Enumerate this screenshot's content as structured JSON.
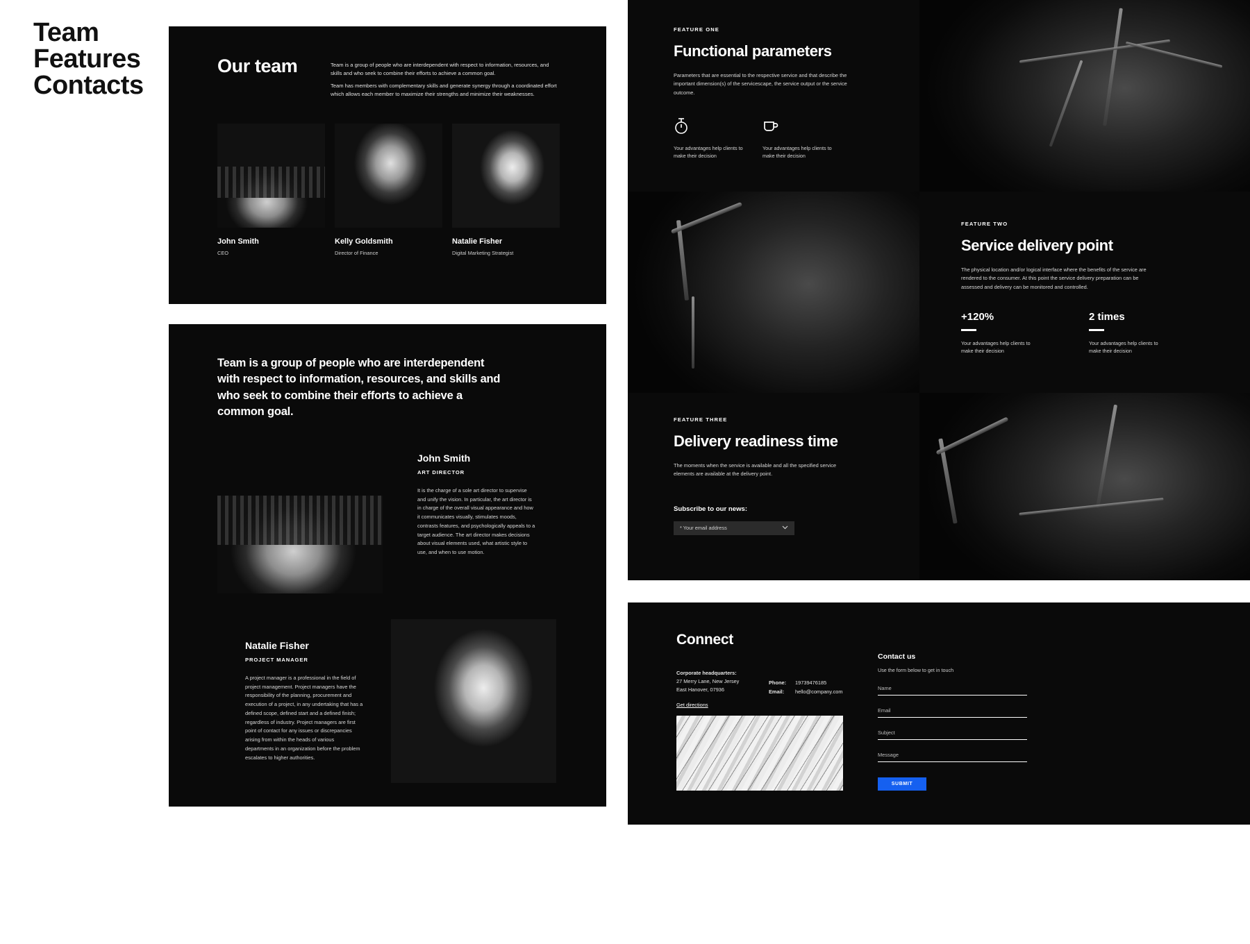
{
  "brand": {
    "title": "Team\nFeatures\nContacts"
  },
  "team_panel": {
    "heading": "Our team",
    "intro_paragraph_1": "Team is a group of people who are interdependent with respect to information, resources, and skills and who seek to combine their efforts to achieve a common goal.",
    "intro_paragraph_2": "Team has members with complementary skills and generate synergy through a coordinated effort which allows each member to maximize their strengths and minimize their weaknesses.",
    "members": [
      {
        "name": "John Smith",
        "role": "CEO",
        "photo": "portrait-man-sunglasses"
      },
      {
        "name": "Kelly Goldsmith",
        "role": "Director of Finance",
        "photo": "portrait-woman-long-hair"
      },
      {
        "name": "Natalie Fisher",
        "role": "Digital Marketing Strategist",
        "photo": "portrait-woman-dark-hair"
      }
    ]
  },
  "bios_panel": {
    "statement": "Team is a group of people who are interdependent with respect to information, resources, and skills and who seek to combine their efforts to achieve a common goal.",
    "bios": [
      {
        "name": "John Smith",
        "role": "ART DIRECTOR",
        "copy": "It is the charge of a sole art director to supervise and unify the vision. In particular, the art director is in charge of the overall visual appearance and how it communicates visually, stimulates moods, contrasts features, and psychologically appeals to a target audience. The art director makes decisions about visual elements used, what artistic style to use, and when to use motion.",
        "photo": "portrait-man-sunglasses"
      },
      {
        "name": "Natalie Fisher",
        "role": "PROJECT MANAGER",
        "copy": "A project manager is a professional in the field of project management. Project managers have the responsibility of the planning, procurement and execution of a project, in any undertaking that has a defined scope, defined start and a defined finish; regardless of industry. Project managers are first point of contact for any issues or discrepancies arising from within the heads of various departments in an organization before the problem escalates to higher authorities.",
        "photo": "portrait-woman-dark-hair"
      }
    ]
  },
  "features": {
    "one": {
      "kicker": "FEATURE ONE",
      "title": "Functional parameters",
      "copy": "Parameters that are essential to the respective service and that describe the important dimension(s) of the servicescape, the service output or the service outcome.",
      "items": [
        {
          "icon": "stopwatch-icon",
          "caption": "Your advantages help clients to make their decision"
        },
        {
          "icon": "coffee-cup-icon",
          "caption": "Your advantages help clients to make their decision"
        }
      ]
    },
    "two": {
      "kicker": "FEATURE TWO",
      "title": "Service delivery point",
      "copy": "The physical location and/or logical interface where the benefits of the service are rendered to the consumer. At this point the service delivery preparation can be assessed and delivery can be monitored and controlled.",
      "stats": [
        {
          "value": "+120%",
          "caption": "Your advantages help clients to make their decision"
        },
        {
          "value": "2 times",
          "caption": "Your advantages help clients to make their decision"
        }
      ]
    },
    "three": {
      "kicker": "FEATURE THREE",
      "title": "Delivery readiness time",
      "copy": "The moments when the service is available and all the specified service elements are available at the delivery point.",
      "subscribe_label": "Subscribe to our news:",
      "subscribe_placeholder": "* Your email address",
      "subscribe_chevron": "chevron-down-icon"
    }
  },
  "connect": {
    "title": "Connect",
    "address_label": "Corporate headquarters:",
    "address_line_1": "27 Merry Lane, New Jersey",
    "address_line_2": "East Hanover, 07936",
    "get_directions": "Get directions",
    "phone_key": "Phone:",
    "phone_value": "19739476185",
    "email_key": "Email:",
    "email_value": "hello@company.com",
    "map_image": "wave-texture-map"
  },
  "contact_form": {
    "title": "Contact us",
    "subtitle": "Use the form below to get in touch",
    "fields": [
      {
        "label": "Name",
        "value": ""
      },
      {
        "label": "Email",
        "value": ""
      },
      {
        "label": "Subject",
        "value": ""
      },
      {
        "label": "Message",
        "value": ""
      }
    ],
    "submit_label": "SUBMIT",
    "submit_color": "#1560f0"
  }
}
